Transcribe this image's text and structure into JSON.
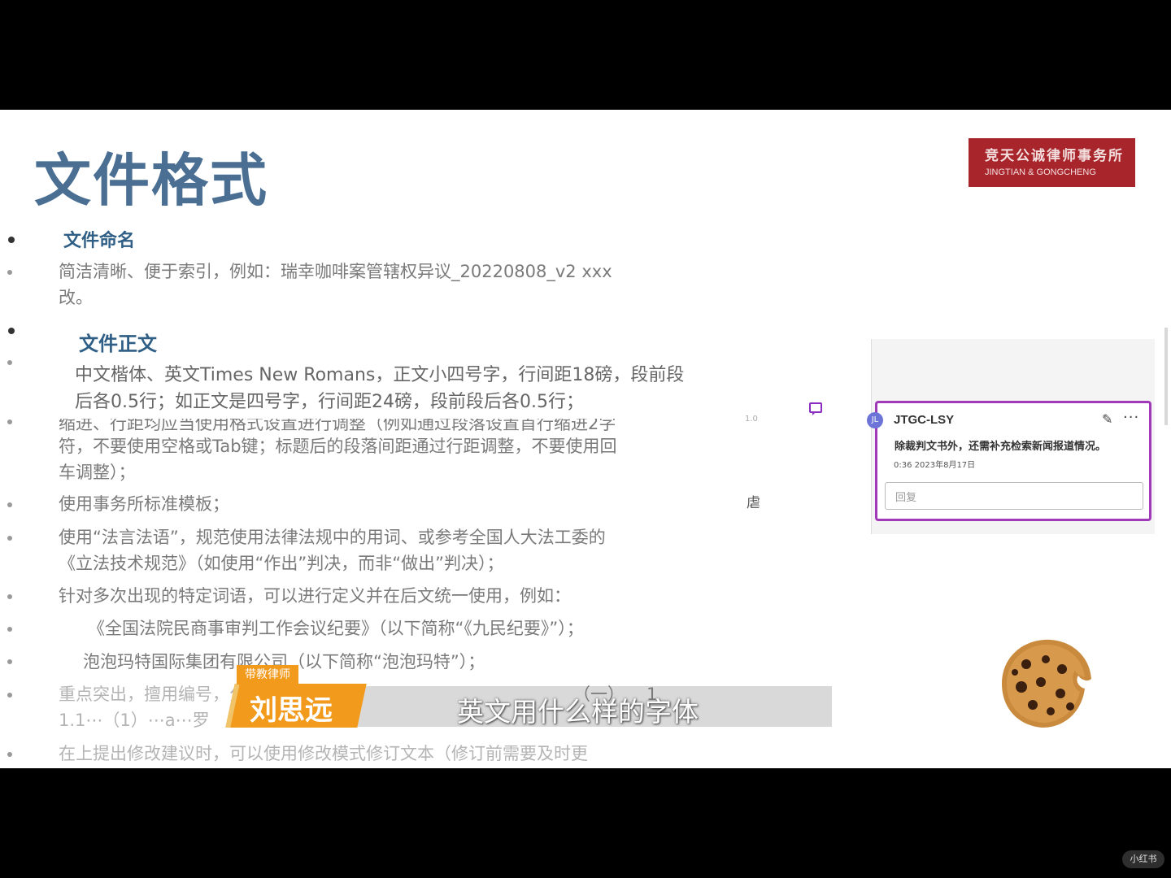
{
  "slide": {
    "title": "文件格式",
    "logo": {
      "name_cn": "竞天公诚律师事务所",
      "name_en": "JINGTIAN & GONGCHENG"
    },
    "sections": {
      "naming_heading": "文件命名",
      "naming_body": [
        "简洁清晰、便于索引，例如：瑞幸咖啡案管辖权异议_20220808_v2 xxx",
        "改。"
      ],
      "body_heading": "文件正文",
      "body_font_lines": [
        "中文楷体、英文Times New Romans，正文小四号字，行间距18磅，段前段",
        "后各0.5行；如正文是四号字，行间距24磅，段前段后各0.5行；"
      ],
      "indent_lines": [
        "缩进、行距均应当使用格式设置进行调整（例如通过段落设置首行缩进2字",
        "符，不要使用空格或Tab键；标题后的段落间距通过行距调整，不要使用回",
        "车调整）；"
      ],
      "template_line": "使用事务所标准模板；",
      "legal_lines": [
        "使用“法言法语”，规范使用法律法规中的用词、或参考全国人大法工委的",
        "《立法技术规范》（如使用“作出”判决，而非“做出”判决）；"
      ],
      "define_line": "针对多次出现的特定词语，可以进行定义并在后文统一使用，例如：",
      "example_1": "《全国法院民商事审判工作会议纪要》（以下简称“《九民纪要》”）；",
      "example_2": "泡泡玛特国际集团有限公司（以下简称“泡泡玛特”）；",
      "numbering_line": "重点突出，擅用编号，分级格式统一为：",
      "numbering_partial": "（一）",
      "numbering_partial_2": "1",
      "numbering_line_2": "1.1⋯（1）⋯a⋯罗",
      "revision_line": "在上提出修改建议时，可以使用修改模式修订文本（修订前需要及时更"
    },
    "margin_mark": "虐",
    "small_mark": "1.0"
  },
  "comment": {
    "avatar_initials": "JL",
    "author": "JTGC-LSY",
    "text": "除裁判文书外，还需补充检索新闻报道情况。",
    "time": "0:36 2023年8月17日",
    "reply_placeholder": "回复",
    "more_label": "···"
  },
  "video_overlay": {
    "tag": "带教律师",
    "name": "刘思远",
    "subtitle": "英文用什么样的字体"
  },
  "watermark": "小红书"
}
